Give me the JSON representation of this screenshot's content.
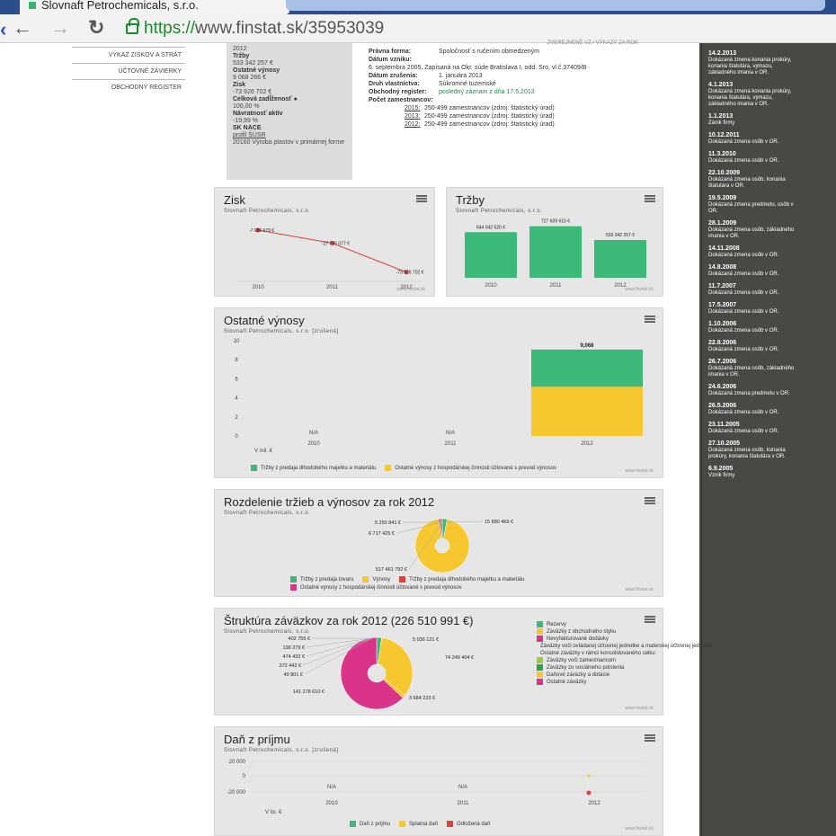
{
  "browser": {
    "tab_title": "Slovnaft Petrochemicals, s.r.o.",
    "url_scheme": "https://",
    "url_rest": "www.finstat.sk/35953039"
  },
  "nav": {
    "items": [
      "VÝKAZ ZISKOV A STRÁT",
      "ÚČTOVNÉ ZÁVIERKY",
      "OBCHODNÝ REGISTER"
    ]
  },
  "info": {
    "year_top": "2012",
    "trzby_label": "Tržby",
    "trzby": "533 342 257 €",
    "ostatne_label": "Ostatné výnosy",
    "ostatne": "9 068 266 €",
    "zisk_label": "Zisk",
    "zisk": "-73 926 702 €",
    "zadlz_label": "Celková zadĺženosť",
    "zadlz": "100,00 %",
    "navr_label": "Návratnosť aktív",
    "navr": "-19,99 %",
    "nace_label": "SK NACE",
    "nace_link": "profil ŠÚSR",
    "nace_desc": "20160 Výroba plastov v primárnej forme"
  },
  "details": {
    "top": "ZVEREJNENÉ VZ / VÝKAZY ZA ROK",
    "forma_k": "Právna forma:",
    "forma_v": "Spoločnosť s ručením obmedzeným",
    "vznik_k": "Dátum vzniku:",
    "vznik_v": "6. septembra 2005, Zapísaná na Okr. súde Bratislava I, odd. Sro, vl.č.37409/B",
    "zrus_k": "Dátum zrušenia:",
    "zrus_v": "1. januára 2013",
    "druh_k": "Druh vlastníctva:",
    "druh_v": "Súkromné tuzemské",
    "reg_k": "Obchodný register:",
    "reg_v": "posledný záznam z dňa 17.5.2013",
    "poc_k": "Počet zamestnancov:",
    "emps": [
      {
        "y": "2015:",
        "t": "250-499 zamestnancov (zdroj: štatistický úrad)"
      },
      {
        "y": "2013:",
        "t": "250-499 zamestnancov (zdroj: štatistický úrad)"
      },
      {
        "y": "2012:",
        "t": "250-499 zamestnancov (zdroj: štatistický úrad)"
      }
    ]
  },
  "events": [
    {
      "d": "14.2.2013",
      "t": "Dokázaná zmena konania prokúry, konania štatutára, výmazu, základného imania v OR."
    },
    {
      "d": "4.1.2013",
      "t": "Dokázaná zmena konania prokúry, konania štatutára, výmazu, základného imania v OR."
    },
    {
      "d": "1.1.2013",
      "t": "Zánik firmy"
    },
    {
      "d": "10.12.2011",
      "t": "Dokázaná zmena osôb v OR."
    },
    {
      "d": "11.3.2010",
      "t": "Dokázaná zmena osôb v OR."
    },
    {
      "d": "22.10.2009",
      "t": "Dokázaná zmena osôb, konania štatutára v OR."
    },
    {
      "d": "19.5.2009",
      "t": "Dokázaná zmena predmetu, osôb v OR."
    },
    {
      "d": "28.1.2009",
      "t": "Dokázaná zmena osôb, základného imania v OR."
    },
    {
      "d": "14.11.2008",
      "t": "Dokázaná zmena osôb v OR."
    },
    {
      "d": "14.8.2008",
      "t": "Dokázaná zmena osôb v OR."
    },
    {
      "d": "11.7.2007",
      "t": "Dokázaná zmena osôb v OR."
    },
    {
      "d": "17.5.2007",
      "t": "Dokázaná zmena osôb v OR."
    },
    {
      "d": "1.10.2006",
      "t": "Dokázaná zmena osôb v OR."
    },
    {
      "d": "22.8.2006",
      "t": "Dokázaná zmena osôb v OR."
    },
    {
      "d": "26.7.2006",
      "t": "Dokázaná zmena osôb, základného imania v OR."
    },
    {
      "d": "24.6.2006",
      "t": "Dokázaná zmena predmetu v OR."
    },
    {
      "d": "26.5.2006",
      "t": "Dokázaná zmena osôb v OR."
    },
    {
      "d": "23.11.2005",
      "t": "Dokázaná zmena osôb v OR."
    },
    {
      "d": "27.10.2005",
      "t": "Dokázaná zmena osôb, konania prokúry, konania štatutára v OR."
    },
    {
      "d": "6.9.2005",
      "t": "Vznik firmy"
    }
  ],
  "colors": {
    "green": "#3cb878",
    "yellow": "#f7c730",
    "pink": "#d9348a",
    "red": "#e04040",
    "cyan": "#45c8d8",
    "grey": "#4a4845"
  },
  "credit": "www.finstat.sk",
  "chart_data": [
    {
      "type": "line",
      "title": "Zisk",
      "subtitle": "Slovnaft Petrochemicals, s.r.o.",
      "categories": [
        "2010",
        "2011",
        "2012"
      ],
      "series": [
        {
          "values": [
            -7080679,
            -27795077,
            -73926702
          ]
        }
      ],
      "labels": [
        "-7 080 679 €",
        "-27 795 077 €",
        "-73 926 702 €"
      ]
    },
    {
      "type": "bar",
      "title": "Tržby",
      "subtitle": "Slovnaft Petrochemicals, s.r.o.",
      "categories": [
        "2010",
        "2011",
        "2012"
      ],
      "values": [
        644042520,
        727609615,
        533342257
      ],
      "labels": [
        "644 042 520 €",
        "727 609 615 €",
        "533 342 257 €"
      ]
    },
    {
      "type": "bar",
      "title": "Ostatné výnosy",
      "subtitle": "Slovnaft Petrochemicals, s.r.o. [zrušená]",
      "categories": [
        "2010",
        "2011",
        "2012"
      ],
      "ylim": [
        0,
        10
      ],
      "yticks": [
        0,
        2,
        4,
        6,
        8,
        10
      ],
      "yunit": "V mil. €",
      "na_label": "N/A",
      "total_label": "9,068",
      "series": [
        {
          "name": "Tržby z predaja dlhodobého majetku a materiálu",
          "values": [
            null,
            null,
            3.9
          ]
        },
        {
          "name": "Ostatné výnosy z hospodárskej činnosti účtované s prevod výnosov",
          "values": [
            null,
            null,
            5.168
          ]
        }
      ]
    },
    {
      "type": "pie",
      "title": "Rozdelenie tržieb a výnosov za rok 2012",
      "subtitle": "Slovnaft Petrochemicals, s.r.o.",
      "slices": [
        {
          "name": "Tržby z predaja tovaru",
          "label": "15 880 465 €",
          "value": 15880465
        },
        {
          "name": "Výnosy",
          "label": "517 461 792 €",
          "value": 517461792
        },
        {
          "name": "Tržby z predaja dlhodobého majetku a materiálu",
          "label": "6 717 425 €",
          "value": 6717425
        },
        {
          "name": "Ostatné výnosy z hospodárskej činnosti účtované s prevod výnosov",
          "label": "5 250 841 €",
          "value": 5250841
        }
      ]
    },
    {
      "type": "pie",
      "title": "Štruktúra záväzkov za rok 2012 (226 510 991 €)",
      "subtitle": "Slovnaft Petrochemicals, s.r.o.",
      "slices": [
        {
          "name": "Rezervy",
          "label": "5 036 121 €",
          "value": 5036121
        },
        {
          "name": "Záväzky z obchodného styku",
          "label": "74 249 404 €",
          "value": 74249404
        },
        {
          "name": "Nevyfakturované dodávky",
          "label": "",
          "value": 0
        },
        {
          "name": "Záväzky voči ovládanej účtovnej jednotke a materskej účtovnej jednotke",
          "label": "",
          "value": 0
        },
        {
          "name": "Ostatné záväzky v rámci konsolidovaného celku",
          "label": "",
          "value": 0
        },
        {
          "name": "Záväzky voči zamestnancom",
          "label": "",
          "value": 0
        },
        {
          "name": "Záväzky zo sociálneho poistenia",
          "label": "",
          "value": 0
        },
        {
          "name": "Daňové záväzky a dotácie",
          "label": "3 684 223 €",
          "value": 3684223
        },
        {
          "name": "Ostatné záväzky",
          "label": "141 278 610 €",
          "value": 141278610
        }
      ],
      "extra_labels": [
        "402 755 €",
        "199 279 €",
        "474 432 €",
        "372 442 €",
        "49 801 €"
      ]
    },
    {
      "type": "line",
      "title": "Daň z príjmu",
      "subtitle": "Slovnaft Petrochemicals, s.r.o. [zrušená]",
      "categories": [
        "2010",
        "2011",
        "2012"
      ],
      "yticks": [
        "20 000",
        "0",
        "-20 000"
      ],
      "yunit": "V tis. €",
      "na_label": "N/A",
      "series": [
        {
          "name": "Daň z príjmu",
          "color": "#3cb878"
        },
        {
          "name": "Splatná daň",
          "color": "#f7c730"
        },
        {
          "name": "Odložená daň",
          "color": "#e04040"
        }
      ]
    }
  ]
}
